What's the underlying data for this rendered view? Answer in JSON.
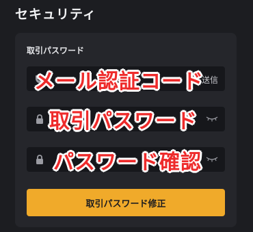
{
  "page": {
    "title": "セキュリティ"
  },
  "trade_password_section": {
    "label": "取引パスワード",
    "fields": [
      {
        "name": "email_code",
        "overlay_label": "メール認証コード",
        "icon": "shield-icon",
        "trailing_text": "送信"
      },
      {
        "name": "trade_password",
        "overlay_label": "取引パスワード",
        "icon": "lock-icon",
        "trailing_icon": "eye-closed-icon"
      },
      {
        "name": "confirm_password",
        "overlay_label": "パスワード確認",
        "icon": "lock-icon",
        "trailing_icon": "eye-closed-icon"
      }
    ],
    "submit_label": "取引パスワード修正"
  },
  "colors": {
    "background": "#1c1d21",
    "card": "#25262b",
    "field": "#16171b",
    "accent": "#f0aa2a",
    "overlay_text": "#ee2b2b"
  }
}
